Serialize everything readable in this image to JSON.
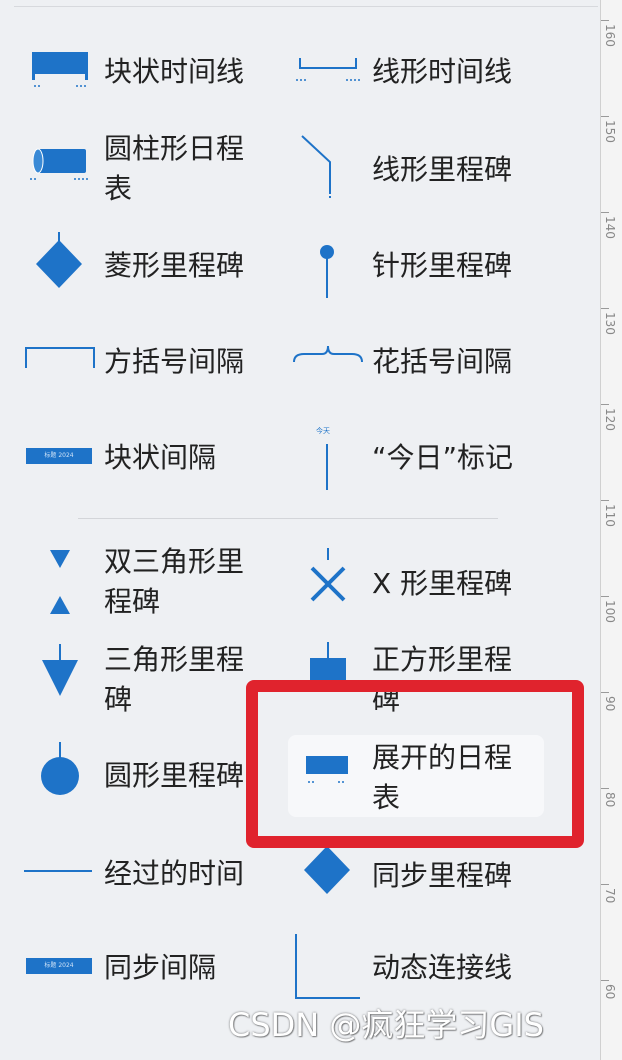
{
  "shapes": {
    "left": [
      {
        "label": "块状时间线"
      },
      {
        "label": "圆柱形日程表"
      },
      {
        "label": "菱形里程碑"
      },
      {
        "label": "方括号间隔"
      },
      {
        "label": "块状间隔",
        "icon_text": "标题 2024"
      },
      {
        "label": "双三角形里程碑"
      },
      {
        "label": "三角形里程碑"
      },
      {
        "label": "圆形里程碑"
      },
      {
        "label": "经过的时间"
      },
      {
        "label": "同步间隔",
        "icon_text": "标题 2024"
      }
    ],
    "right": [
      {
        "label": "线形时间线"
      },
      {
        "label": "线形里程碑"
      },
      {
        "label": "针形里程碑"
      },
      {
        "label": "花括号间隔"
      },
      {
        "label": "“今日”标记",
        "icon_text": "今天"
      },
      {
        "label": "X 形里程碑"
      },
      {
        "label": "正方形里程碑"
      },
      {
        "label": "展开的日程表"
      },
      {
        "label": "同步里程碑"
      },
      {
        "label": "动态连接线"
      }
    ]
  },
  "ruler": {
    "labels": [
      "160",
      "150",
      "140",
      "130",
      "120",
      "110",
      "100",
      "90",
      "80",
      "70",
      "60"
    ]
  },
  "watermark": "CSDN @疯狂学习GIS",
  "colors": {
    "accent": "#1e73c8",
    "highlight": "#e0232d",
    "background": "#eef0f3"
  }
}
